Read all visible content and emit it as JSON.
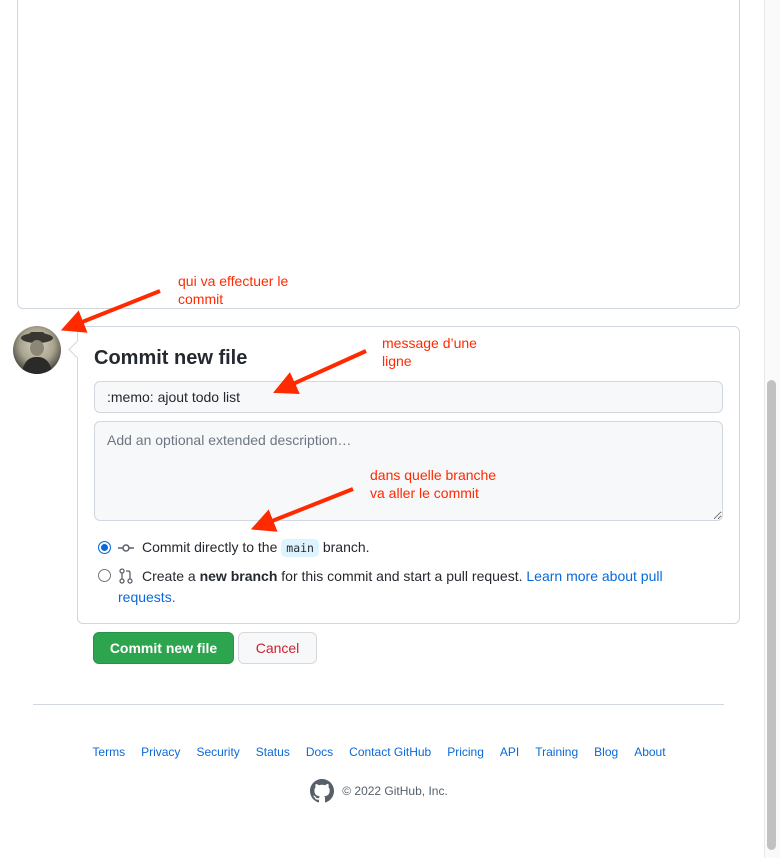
{
  "form": {
    "title": "Commit new file",
    "summary_value": ":memo: ajout todo list",
    "description_placeholder": "Add an optional extended description…",
    "option_direct": {
      "prefix": "Commit directly to the",
      "branch": "main",
      "suffix": "branch."
    },
    "option_new": {
      "prefix": "Create a",
      "bold": "new branch",
      "middle": "for this commit and start a pull request.",
      "link": "Learn more about pull requests."
    },
    "commit_button": "Commit new file",
    "cancel_button": "Cancel"
  },
  "footer": {
    "links": [
      "Terms",
      "Privacy",
      "Security",
      "Status",
      "Docs",
      "Contact GitHub",
      "Pricing",
      "API",
      "Training",
      "Blog",
      "About"
    ],
    "copyright": "© 2022 GitHub, Inc."
  },
  "annotations": {
    "author": "qui va effectuer le commit",
    "message": "message d’une ligne",
    "branch": "dans quelle branche va aller le commit"
  },
  "colors": {
    "primary": "#2da44e",
    "link": "#0969da",
    "danger": "#cf222e",
    "annotation": "#ff2a00"
  }
}
